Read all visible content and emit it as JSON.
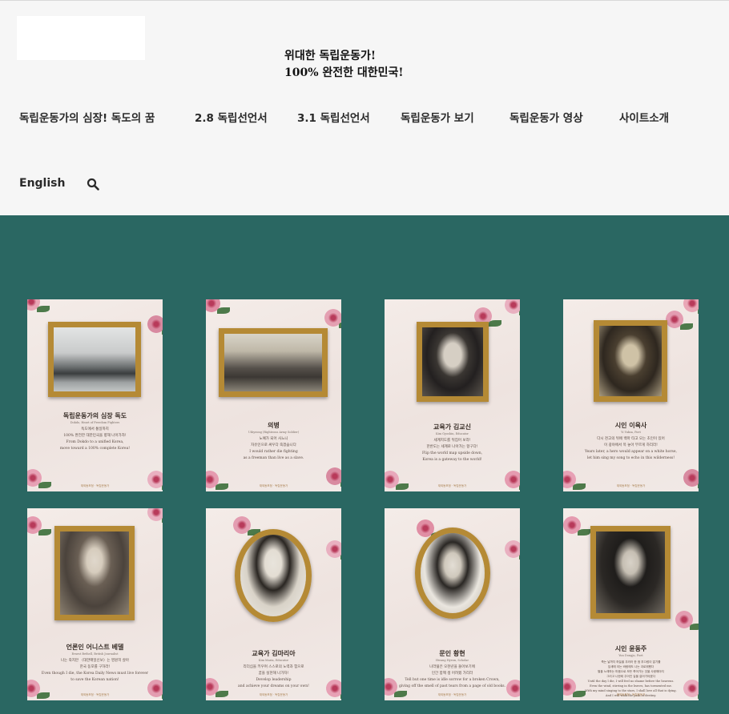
{
  "header": {
    "tagline": [
      "위대한 독립운동가!",
      "100% 완전한 대한민국!"
    ],
    "nav": [
      "독립운동가의 심장! 독도의 꿈",
      "2.8 독립선언서",
      "3.1 독립선언서",
      "독립운동가 보기",
      "독립운동가 영상",
      "사이트소개"
    ],
    "lang": "English",
    "search_icon": "search-icon"
  },
  "colors": {
    "accent_bg": "#2a6762",
    "header_bg": "#f6f6f6",
    "frame_gold": "#b58a35"
  },
  "cards": [
    {
      "title": "독립운동가의 심장 독도",
      "sub": "Dokdo, Heart of Freedom Fighters",
      "lines": [
        "독도에서 통일까지",
        "100% 완전한 대한민국을 향해 나아가자!",
        "From Dokdo to a unified Korea,",
        "move toward a 100% complete Korea!"
      ],
      "foot": "재외동포청 · 독립운동가"
    },
    {
      "title": "의병",
      "sub": "Uibyeong (Righteous Army Soldier)",
      "lines": [
        "노예가 되어 사느니",
        "자유인으로 싸우다 죽겠습니다",
        "I would rather die fighting",
        "as a freeman than live as a slave."
      ],
      "foot": "재외동포청 · 독립운동가"
    },
    {
      "title": "교육가 김교신",
      "sub": "Kim Gyoshin, Educator",
      "lines": [
        "세계지도를 뒤집어 보라!",
        "한반도는 세계로 나아가는 항구다!",
        "Flip the world map upside down,",
        "Korea is a gateway to the world!"
      ],
      "foot": "재외동포청 · 독립운동가"
    },
    {
      "title": "시인 이육사",
      "sub": "Yi Yuksa, Poet",
      "lines": [
        "다시 천고의 뒤에 백마 타고 오는 초인이 있어",
        "이 광야에서 목 놓아 부르게 하리라!",
        "Years later, a hero would appear on a white horse,",
        "let him sing my song to echo in this wilderness!"
      ],
      "foot": "재외동포청 · 독립운동가"
    },
    {
      "title": "언론인 어니스트 베델",
      "sub": "Ernest Bethell, British Journalist",
      "lines": [
        "나는 죽지만 〈대한매일신보〉는 영원히 살아",
        "한국 동포를 구하라!",
        "Even though I die, the Korea Daily News must live forever",
        "to save the Korean nation!"
      ],
      "foot": "재외동포청 · 독립운동가"
    },
    {
      "title": "교육가 김마리아",
      "sub": "Kim Maria, Educator",
      "lines": [
        "리더십을 키우며 스스로의 노력과 힘으로",
        "꿈을 실현해 나가자!",
        "Develop leadership",
        "and achieve your dreams on your own!"
      ],
      "foot": "재외동포청 · 독립운동가"
    },
    {
      "title": "문인 황현",
      "sub": "Hwang Hyeon, Scholar",
      "lines": [
        "나라잃은 오천년을 돌아보기에",
        "인간 함께 생 어려웠 가리라",
        "Tell but one time is idle sorrow for a broken Crown,",
        "giving off the smell of past tears from a page of old books."
      ],
      "foot": "재외동포청 · 독립운동가"
    },
    {
      "title": "시인 윤동주",
      "sub": "Yun Dongju, Poet",
      "lines": [
        "죽는 날까지 하늘을 우러러 한 점 부끄럼이 없기를",
        "잎새에 이는 바람에도 나는 괴로워했다",
        "별을 노래하는 마음으로 모든 죽어가는 것을 사랑해야지",
        "그리고 나한테 주어진 길을 걸어가야겠다",
        "Until the day I die, I will feel no shame before the heavens.",
        "Even the wind, stirring in the leaves, has tormented me.",
        "With my mind singing to the stars, I shall love all that is dying.",
        "And I will walk the path of destiny."
      ],
      "foot": "재외동포청 · 독립운동가"
    }
  ]
}
